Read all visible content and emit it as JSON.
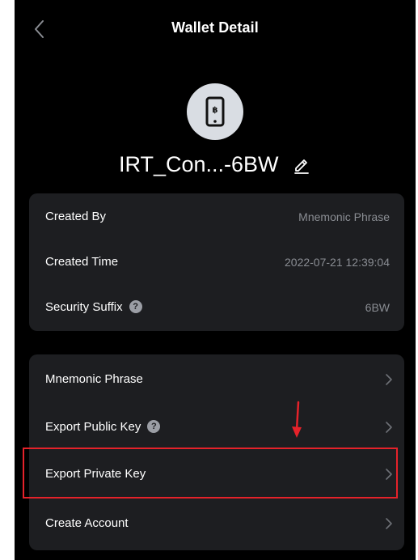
{
  "nav": {
    "title": "Wallet Detail",
    "back_icon": "chevron-left-icon"
  },
  "wallet": {
    "avatar_icon": "bitcoin-phone-icon",
    "name": "IRT_Con...-6BW",
    "edit_icon": "pencil-icon"
  },
  "info": [
    {
      "label": "Created By",
      "value": "Mnemonic Phrase"
    },
    {
      "label": "Created Time",
      "value": "2022-07-21 12:39:04"
    },
    {
      "label": "Security Suffix",
      "value": "6BW",
      "help": "?"
    }
  ],
  "actions": [
    {
      "label": "Mnemonic Phrase"
    },
    {
      "label": "Export Public Key",
      "help": "?"
    },
    {
      "label": "Export Private Key",
      "highlighted": true
    },
    {
      "label": "Create Account"
    }
  ],
  "annotation": {
    "color": "#e5222a",
    "arrow_icon": "arrow-down-icon"
  },
  "colors": {
    "background": "#000000",
    "card": "#1d1e21",
    "text": "#ffffff",
    "muted": "#8a8d93"
  }
}
